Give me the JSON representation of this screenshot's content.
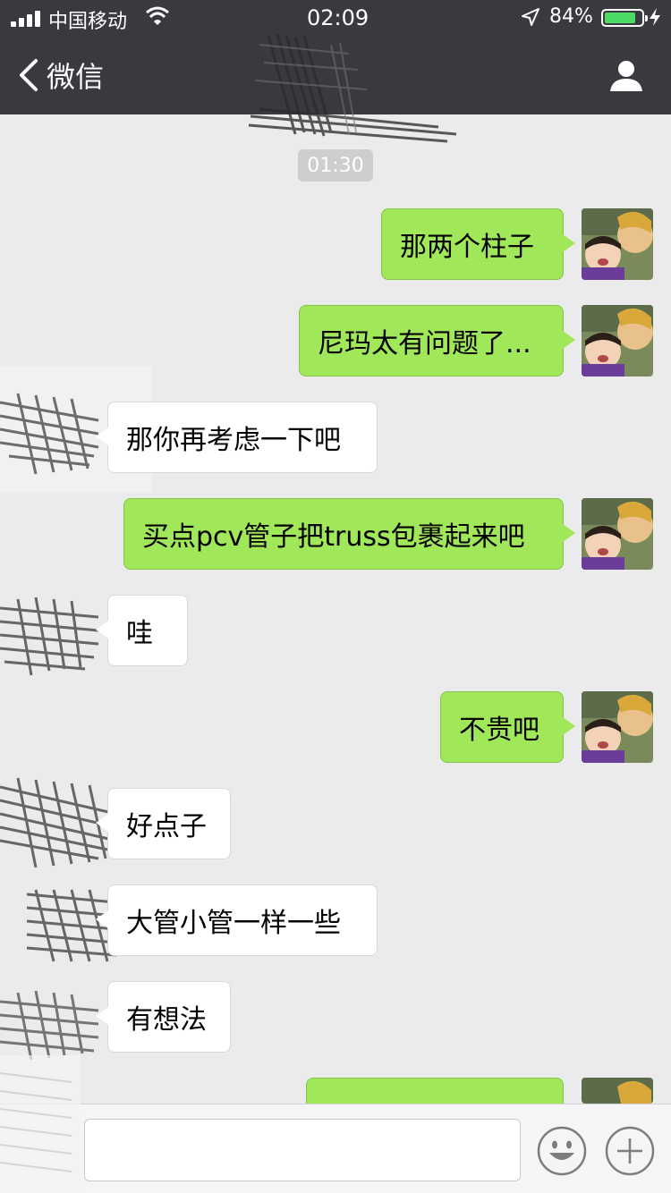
{
  "status_bar": {
    "carrier": "中国移动",
    "time": "02:09",
    "battery_percent": "84%",
    "battery_color": "#4cd964"
  },
  "nav": {
    "back_label": "微信",
    "back_icon": "chevron-left-icon",
    "profile_icon": "user-icon"
  },
  "chat": {
    "timestamp": "01:30",
    "messages": [
      {
        "side": "out",
        "text": "那两个柱子"
      },
      {
        "side": "out",
        "text": "尼玛太有问题了..."
      },
      {
        "side": "in",
        "text": "那你再考虑一下吧"
      },
      {
        "side": "out",
        "text": "买点pcv管子把truss包裹起来吧"
      },
      {
        "side": "in",
        "text": "哇"
      },
      {
        "side": "out",
        "text": "不贵吧"
      },
      {
        "side": "in",
        "text": "好点子"
      },
      {
        "side": "in",
        "text": "大管小管一样一些"
      },
      {
        "side": "in",
        "text": "有想法"
      }
    ]
  },
  "input_bar": {
    "placeholder": "",
    "emoji_icon": "smiley-icon",
    "plus_icon": "plus-icon"
  },
  "colors": {
    "nav_bg": "#393a3f",
    "chat_bg": "#ebebeb",
    "outgoing_bubble": "#a0e75a",
    "incoming_bubble": "#ffffff"
  }
}
